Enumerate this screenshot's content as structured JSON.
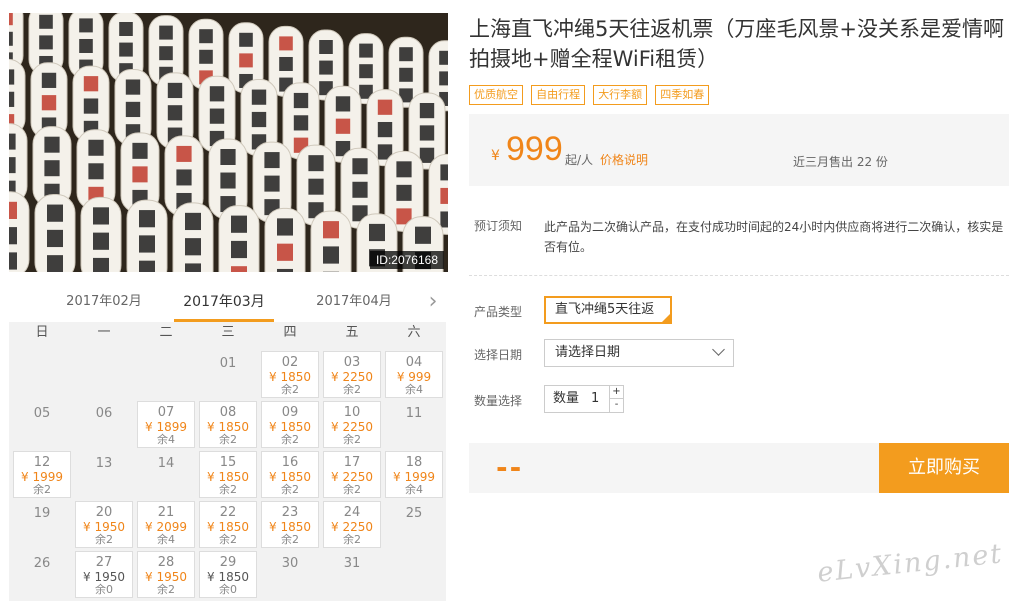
{
  "hero": {
    "image_id": "ID:2076168"
  },
  "calendar": {
    "months": [
      "2017年02月",
      "2017年03月",
      "2017年04月"
    ],
    "active_month": 1,
    "weekdays": [
      "日",
      "一",
      "二",
      "三",
      "四",
      "五",
      "六"
    ],
    "days": [
      {
        "d": "01",
        "state": "plain"
      },
      {
        "d": "02",
        "price": "¥ 1850",
        "stock": "余2",
        "state": "avail"
      },
      {
        "d": "03",
        "price": "¥ 2250",
        "stock": "余2",
        "state": "avail"
      },
      {
        "d": "04",
        "price": "¥ 999",
        "stock": "余4",
        "state": "avail"
      },
      {
        "d": "05",
        "state": "plain"
      },
      {
        "d": "06",
        "state": "plain"
      },
      {
        "d": "07",
        "price": "¥ 1899",
        "stock": "余4",
        "state": "avail"
      },
      {
        "d": "08",
        "price": "¥ 1850",
        "stock": "余2",
        "state": "avail"
      },
      {
        "d": "09",
        "price": "¥ 1850",
        "stock": "余2",
        "state": "avail"
      },
      {
        "d": "10",
        "price": "¥ 2250",
        "stock": "余2",
        "state": "avail"
      },
      {
        "d": "11",
        "state": "plain"
      },
      {
        "d": "12",
        "price": "¥ 1999",
        "stock": "余2",
        "state": "avail"
      },
      {
        "d": "13",
        "state": "plain"
      },
      {
        "d": "14",
        "state": "plain"
      },
      {
        "d": "15",
        "price": "¥ 1850",
        "stock": "余2",
        "state": "avail"
      },
      {
        "d": "16",
        "price": "¥ 1850",
        "stock": "余2",
        "state": "avail"
      },
      {
        "d": "17",
        "price": "¥ 2250",
        "stock": "余2",
        "state": "avail"
      },
      {
        "d": "18",
        "price": "¥ 1999",
        "stock": "余4",
        "state": "avail"
      },
      {
        "d": "19",
        "state": "plain"
      },
      {
        "d": "20",
        "price": "¥ 1950",
        "stock": "余2",
        "state": "avail"
      },
      {
        "d": "21",
        "price": "¥ 2099",
        "stock": "余4",
        "state": "avail"
      },
      {
        "d": "22",
        "price": "¥ 1850",
        "stock": "余2",
        "state": "avail"
      },
      {
        "d": "23",
        "price": "¥ 1850",
        "stock": "余2",
        "state": "avail"
      },
      {
        "d": "24",
        "price": "¥ 2250",
        "stock": "余2",
        "state": "avail"
      },
      {
        "d": "25",
        "state": "plain"
      },
      {
        "d": "26",
        "state": "plain"
      },
      {
        "d": "27",
        "price": "¥ 1950",
        "stock": "余0",
        "state": "sold"
      },
      {
        "d": "28",
        "price": "¥ 1950",
        "stock": "余2",
        "state": "avail"
      },
      {
        "d": "29",
        "price": "¥ 1850",
        "stock": "余0",
        "state": "sold"
      },
      {
        "d": "30",
        "state": "plain"
      },
      {
        "d": "31",
        "state": "plain"
      }
    ]
  },
  "product": {
    "title": "上海直飞冲绳5天往返机票（万座毛风景+没关系是爱情啊拍摄地+赠全程WiFi租赁）",
    "tags": [
      "优质航空",
      "自由行程",
      "大行李额",
      "四季如春"
    ],
    "price": {
      "currency": "¥",
      "amount": "999",
      "unit": "起/人",
      "explain_link": "价格说明",
      "sold_text": "近三月售出 22 份"
    },
    "notice": {
      "label": "预订须知",
      "text": "此产品为二次确认产品，在支付成功时间起的24小时内供应商将进行二次确认，核实是否有位。"
    },
    "options": {
      "type_label": "产品类型",
      "type_value": "直飞冲绳5天往返",
      "date_label": "选择日期",
      "date_placeholder": "请选择日期",
      "qty_label": "数量选择",
      "qty_text": "数量",
      "qty_value": "1",
      "plus": "+",
      "minus": "-"
    },
    "buy": {
      "total": "--",
      "button": "立即购买"
    }
  },
  "watermark": "eLvXing.net",
  "colors": {
    "accent": "#f39c1e",
    "price": "#f08519"
  }
}
